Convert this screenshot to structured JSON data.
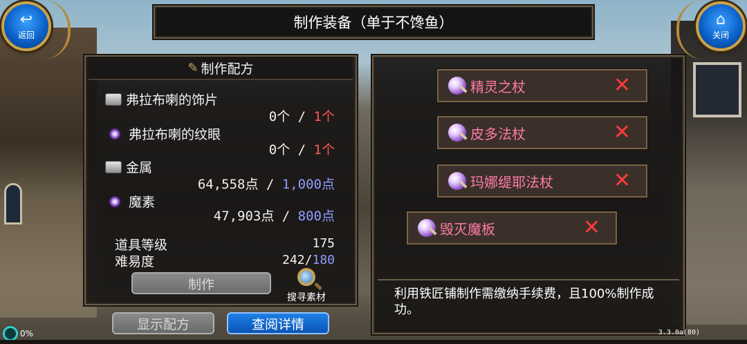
{
  "window": {
    "title": "制作装备（单于不馋鱼）"
  },
  "nav": {
    "back_label": "返回",
    "close_label": "关闭"
  },
  "recipe": {
    "tab_title": "制作配方",
    "materials": [
      {
        "icon": "metal-ingot-icon",
        "name": "弗拉布喇的饰片",
        "have": "0个",
        "need": "1个"
      },
      {
        "icon": "purple-orb-icon",
        "name": "弗拉布喇的纹眼",
        "have": "0个",
        "need": "1个"
      },
      {
        "icon": "metal-ingot-icon",
        "name": "金属",
        "have": "64,558点",
        "need": "1,000点"
      },
      {
        "icon": "purple-orb-icon",
        "name": "魔素",
        "have": "47,903点",
        "need": "800点"
      }
    ],
    "separator": " / ",
    "item_level_label": "道具等级",
    "item_level_value": "175",
    "difficulty_label": "难易度",
    "difficulty_current": "242/",
    "difficulty_max": "180",
    "make_label": "制作",
    "search_material_label": "搜寻素材"
  },
  "buttons": {
    "show_recipe": "显示配方",
    "view_details": "查阅详情"
  },
  "list": {
    "items": [
      {
        "name": "精灵之杖"
      },
      {
        "name": "皮多法杖"
      },
      {
        "name": "玛娜缇耶法杖"
      },
      {
        "name": "毁灭魔板"
      }
    ],
    "remove_symbol": "✕"
  },
  "info": {
    "text": "利用铁匠铺制作需缴纳手续费，且100%制作成功。"
  },
  "status": {
    "progress_percent": "0%",
    "version": "3.3.0a(80)"
  },
  "colors": {
    "need_red": "#ff5a5a",
    "need_blue": "#8f9dff",
    "item_name": "#ff7aa8",
    "remove_x": "#ff3b3b",
    "primary_button": "#0b55b6"
  }
}
